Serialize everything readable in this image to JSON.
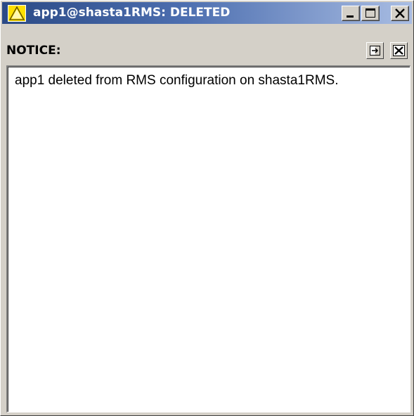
{
  "window": {
    "title": "app1@shasta1RMS: DELETED",
    "title_icon": "warning-triangle-icon",
    "controls": {
      "minimize_icon": "minimize-icon",
      "maximize_icon": "maximize-icon",
      "close_icon": "close-icon"
    },
    "colors": {
      "titlebar_start": "#2b4a86",
      "titlebar_end": "#a9bde3",
      "face": "#d4d0c8",
      "warning_yellow": "#ffe000"
    }
  },
  "notice": {
    "label": "NOTICE:",
    "detach_icon": "detach-arrow-icon",
    "dismiss_icon": "close-icon"
  },
  "message": {
    "text": "app1 deleted from RMS configuration on shasta1RMS."
  }
}
